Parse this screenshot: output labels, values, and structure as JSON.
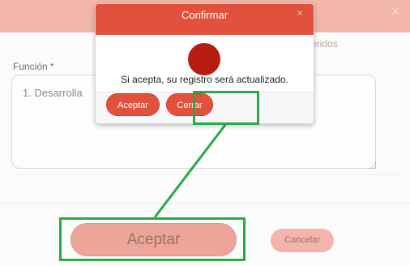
{
  "background_form": {
    "close_glyph": "×",
    "required_note": "eridos",
    "field_label": "Función *",
    "field_value": "1. Desarrolla",
    "accept_label": "Aceptar",
    "cancel_label": "Cancelar"
  },
  "confirm_dialog": {
    "title": "Confirmar",
    "close_glyph": "×",
    "message": "Si acepta, su registro será actualizado.",
    "accept_label": "Aceptar",
    "close_label": "Cerrar"
  },
  "colors": {
    "accent": "#e1513b",
    "highlight": "#2aa84a",
    "icon_circle": "#b71c12"
  }
}
